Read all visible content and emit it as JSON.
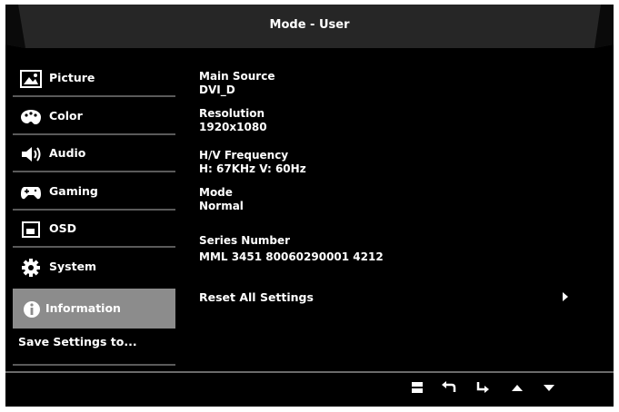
{
  "header": {
    "title": "Mode - User"
  },
  "menu": {
    "items": [
      {
        "label": "Picture",
        "icon": "picture-icon"
      },
      {
        "label": "Color",
        "icon": "palette-icon"
      },
      {
        "label": "Audio",
        "icon": "speaker-icon"
      },
      {
        "label": "Gaming",
        "icon": "gamepad-icon"
      },
      {
        "label": "OSD",
        "icon": "osd-icon"
      },
      {
        "label": "System",
        "icon": "gear-icon"
      },
      {
        "label": "Information",
        "icon": "info-icon",
        "active": true
      }
    ],
    "save_label": "Save Settings to..."
  },
  "info": {
    "main_source_label": "Main Source",
    "main_source_value": "DVI_D",
    "resolution_label": "Resolution",
    "resolution_value": "1920x1080",
    "frequency_label": "H/V Frequency",
    "frequency_value": "H:  67KHz V:  60Hz",
    "mode_label": "Mode",
    "mode_value": "Normal",
    "serial_label": "Series Number",
    "serial_value": "MML 3451 80060290001 4212"
  },
  "reset": {
    "label": "Reset All Settings"
  },
  "buttons": [
    "menu-button",
    "back-button",
    "enter-button",
    "up-button",
    "down-button"
  ],
  "colors": {
    "background": "#000000",
    "active_item": "#8c8c8c",
    "text": "#ffffff"
  }
}
